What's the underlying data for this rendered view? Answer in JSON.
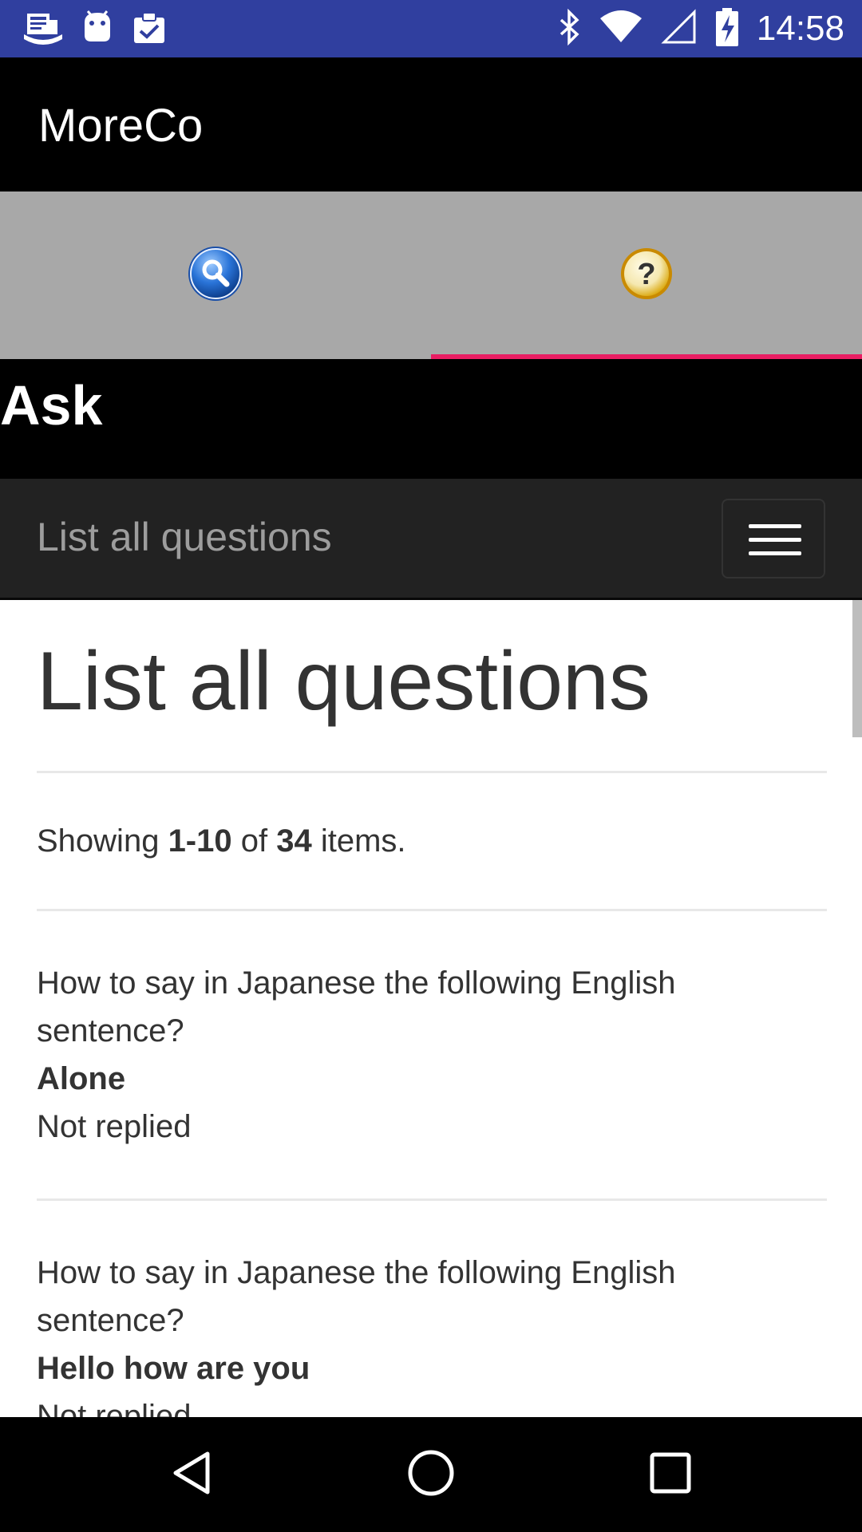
{
  "status_bar": {
    "time": "14:58",
    "icons_left": [
      "newspaper-icon",
      "android-debug-icon",
      "clipboard-check-icon"
    ],
    "icons_right": [
      "bluetooth-icon",
      "wifi-icon",
      "signal-icon",
      "battery-charging-icon"
    ],
    "background": "#303f9f"
  },
  "app_bar": {
    "title": "MoreCo"
  },
  "tabs": [
    {
      "icon": "search-icon",
      "selected": false
    },
    {
      "icon": "help-icon",
      "selected": true
    }
  ],
  "accent_color": "#e91e63",
  "webview": {
    "header": "Ask",
    "navbar_brand": "List all questions",
    "page_title": "List all questions",
    "summary": {
      "prefix": "Showing ",
      "range": "1-10",
      "middle": " of ",
      "total": "34",
      "suffix": " items."
    },
    "items": [
      {
        "question": "How to say in Japanese the following English sentence?",
        "sentence": "Alone",
        "status": "Not replied"
      },
      {
        "question": "How to say in Japanese the following English sentence?",
        "sentence": "Hello how are you",
        "status": "Not replied"
      }
    ]
  },
  "system_nav": [
    "back-icon",
    "home-icon",
    "recents-icon"
  ]
}
